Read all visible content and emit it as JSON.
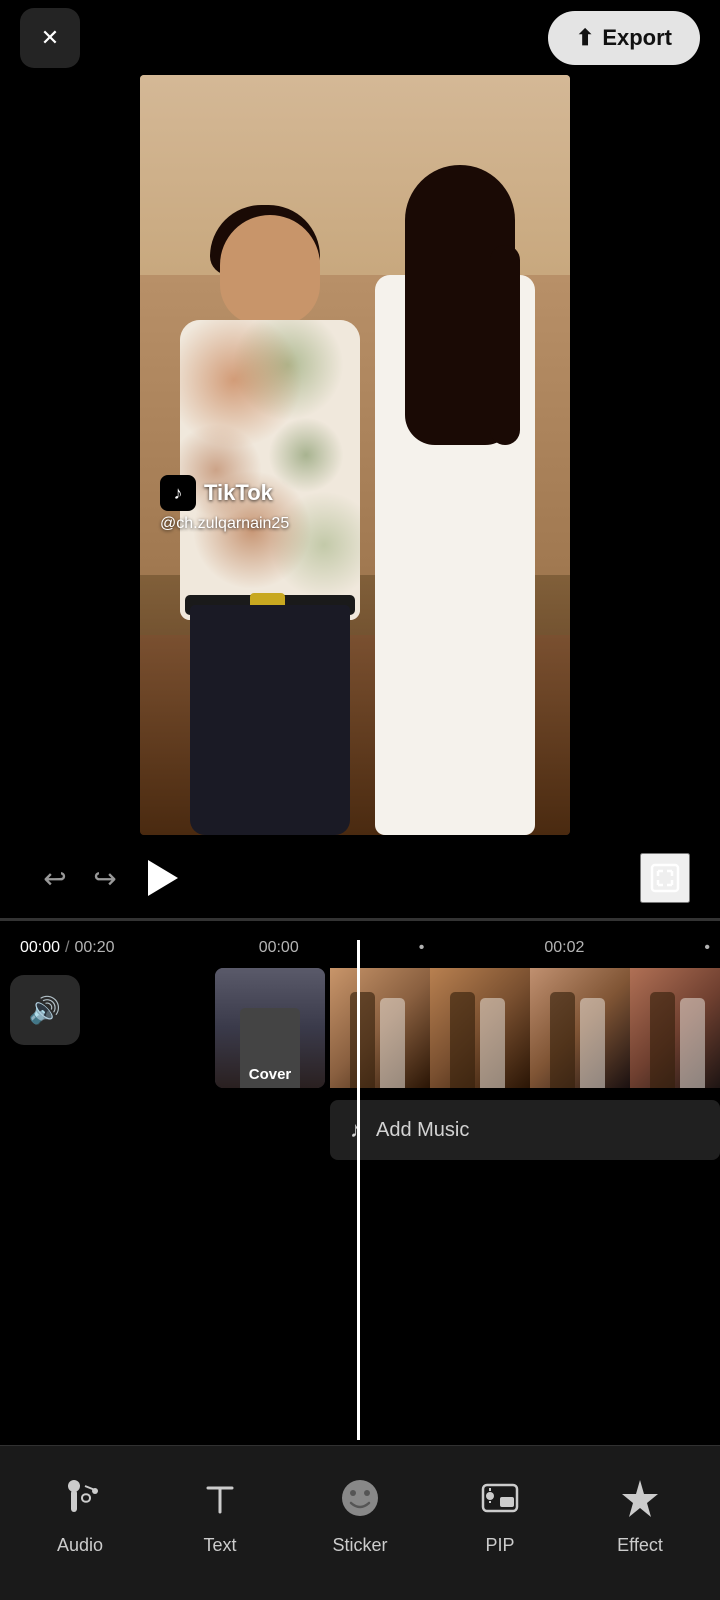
{
  "header": {
    "close_label": "✕",
    "export_label": "Export"
  },
  "video": {
    "tiktok_text": "TikTok",
    "username": "@ch.zulqarnain25"
  },
  "controls": {
    "undo_label": "↩",
    "redo_label": "↪",
    "time_current": "00:00",
    "time_separator": "/",
    "time_total": "00:20",
    "marker1": "00:00",
    "marker2": "00:02",
    "dot1": "•",
    "dot2": "•"
  },
  "timeline": {
    "cover_label": "Cover",
    "add_music_label": "Add Music"
  },
  "toolbar": {
    "audio_label": "Audio",
    "text_label": "Text",
    "sticker_label": "Sticker",
    "pip_label": "PIP",
    "effect_label": "Effect"
  }
}
